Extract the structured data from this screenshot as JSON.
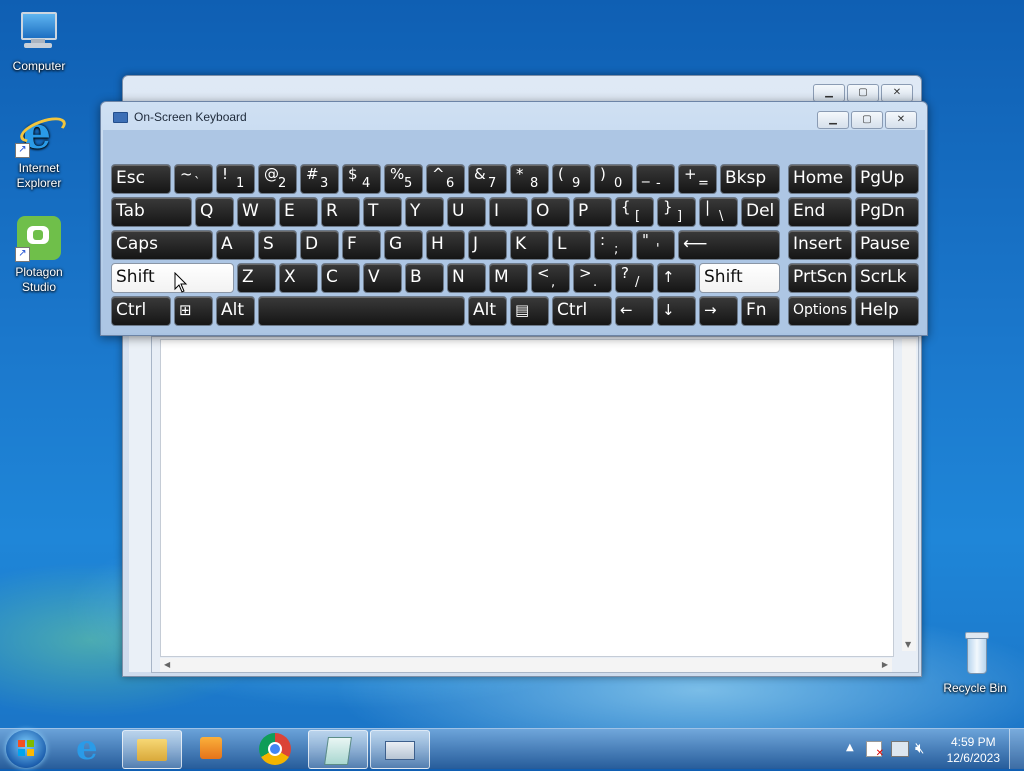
{
  "desktop": {
    "computer": "Computer",
    "ie": "Internet Explorer",
    "plotagon": "Plotagon Studio",
    "recycle": "Recycle Bin"
  },
  "osk": {
    "title": "On-Screen Keyboard",
    "caption": {
      "min": "▭",
      "max": "▣",
      "close": "✕"
    }
  },
  "keys": {
    "esc": "Esc",
    "tilde": [
      "~",
      "`"
    ],
    "k1": [
      "!",
      "1"
    ],
    "k2": [
      "@",
      "2"
    ],
    "k3": [
      "#",
      "3"
    ],
    "k4": [
      "$",
      "4"
    ],
    "k5": [
      "%",
      "5"
    ],
    "k6": [
      "^",
      "6"
    ],
    "k7": [
      "&",
      "7"
    ],
    "k8": [
      "*",
      "8"
    ],
    "k9": [
      "(",
      "9"
    ],
    "k0": [
      ")",
      "0"
    ],
    "minus": [
      "_",
      "-"
    ],
    "equals": [
      "+",
      "="
    ],
    "bksp": "Bksp",
    "home": "Home",
    "pgup": "PgUp",
    "tab": "Tab",
    "q": "Q",
    "w": "W",
    "e": "E",
    "r": "R",
    "t": "T",
    "y": "Y",
    "u": "U",
    "i": "I",
    "o": "O",
    "p": "P",
    "lbracket": [
      "{",
      "["
    ],
    "rbracket": [
      "}",
      "]"
    ],
    "backslash": [
      "|",
      "\\"
    ],
    "del": "Del",
    "end": "End",
    "pgdn": "PgDn",
    "caps": "Caps",
    "a": "A",
    "s": "S",
    "d": "D",
    "f": "F",
    "g": "G",
    "h": "H",
    "j": "J",
    "k": "K",
    "l": "L",
    "semicolon": [
      ":",
      ";"
    ],
    "quote": [
      "\"",
      "'"
    ],
    "enter": "⟵",
    "insert": "Insert",
    "pause": "Pause",
    "shift_l": "Shift",
    "z": "Z",
    "x": "X",
    "c": "C",
    "v": "V",
    "b": "B",
    "n": "N",
    "m": "M",
    "comma": [
      "<",
      ","
    ],
    "period": [
      ">",
      "."
    ],
    "slash": [
      "?",
      "/"
    ],
    "up": "↑",
    "shift_r": "Shift",
    "prtscn": "PrtScn",
    "scrlk": "ScrLk",
    "ctrl_l": "Ctrl",
    "win": "⊞",
    "alt_l": "Alt",
    "space": "",
    "alt_r": "Alt",
    "menu": "▤",
    "ctrl_r": "Ctrl",
    "left": "←",
    "down": "↓",
    "right": "→",
    "fn": "Fn",
    "options": "Options",
    "help": "Help"
  },
  "taskbar": {
    "time": "4:59 PM",
    "date": "12/6/2023"
  }
}
